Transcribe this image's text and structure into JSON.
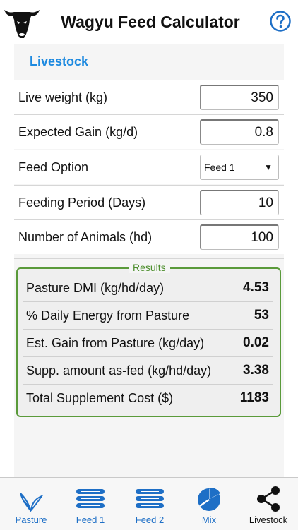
{
  "header": {
    "title": "Wagyu Feed Calculator",
    "help_icon": "question-circle-icon",
    "logo_icon": "cow-head-logo"
  },
  "section": {
    "title": "Livestock"
  },
  "inputs": [
    {
      "label": "Live weight (kg)",
      "value": "350"
    },
    {
      "label": "Expected Gain (kg/d)",
      "value": "0.8"
    },
    {
      "label": "Feed Option",
      "value": "Feed 1",
      "type": "select"
    },
    {
      "label": "Feeding Period (Days)",
      "value": "10"
    },
    {
      "label": "Number of Animals (hd)",
      "value": "100"
    }
  ],
  "results": {
    "legend": "Results",
    "rows": [
      {
        "label": "Pasture DMI (kg/hd/day)",
        "value": "4.53"
      },
      {
        "label": "% Daily Energy from Pasture",
        "value": "53"
      },
      {
        "label": "Est. Gain from Pasture (kg/day)",
        "value": "0.02"
      },
      {
        "label": "Supp. amount as-fed (kg/hd/day)",
        "value": "3.38"
      },
      {
        "label": "Total Supplement Cost ($)",
        "value": "1183"
      }
    ]
  },
  "tabs": [
    {
      "label": "Pasture",
      "icon": "sprout-icon"
    },
    {
      "label": "Feed 1",
      "icon": "list-icon"
    },
    {
      "label": "Feed 2",
      "icon": "list-icon"
    },
    {
      "label": "Mix",
      "icon": "pie-chart-icon"
    },
    {
      "label": "Livestock",
      "icon": "share-icon",
      "active": true
    }
  ],
  "colors": {
    "accent": "#1e8ae0",
    "results_border": "#5a9a3a",
    "tab_icon": "#1e6fc6"
  }
}
